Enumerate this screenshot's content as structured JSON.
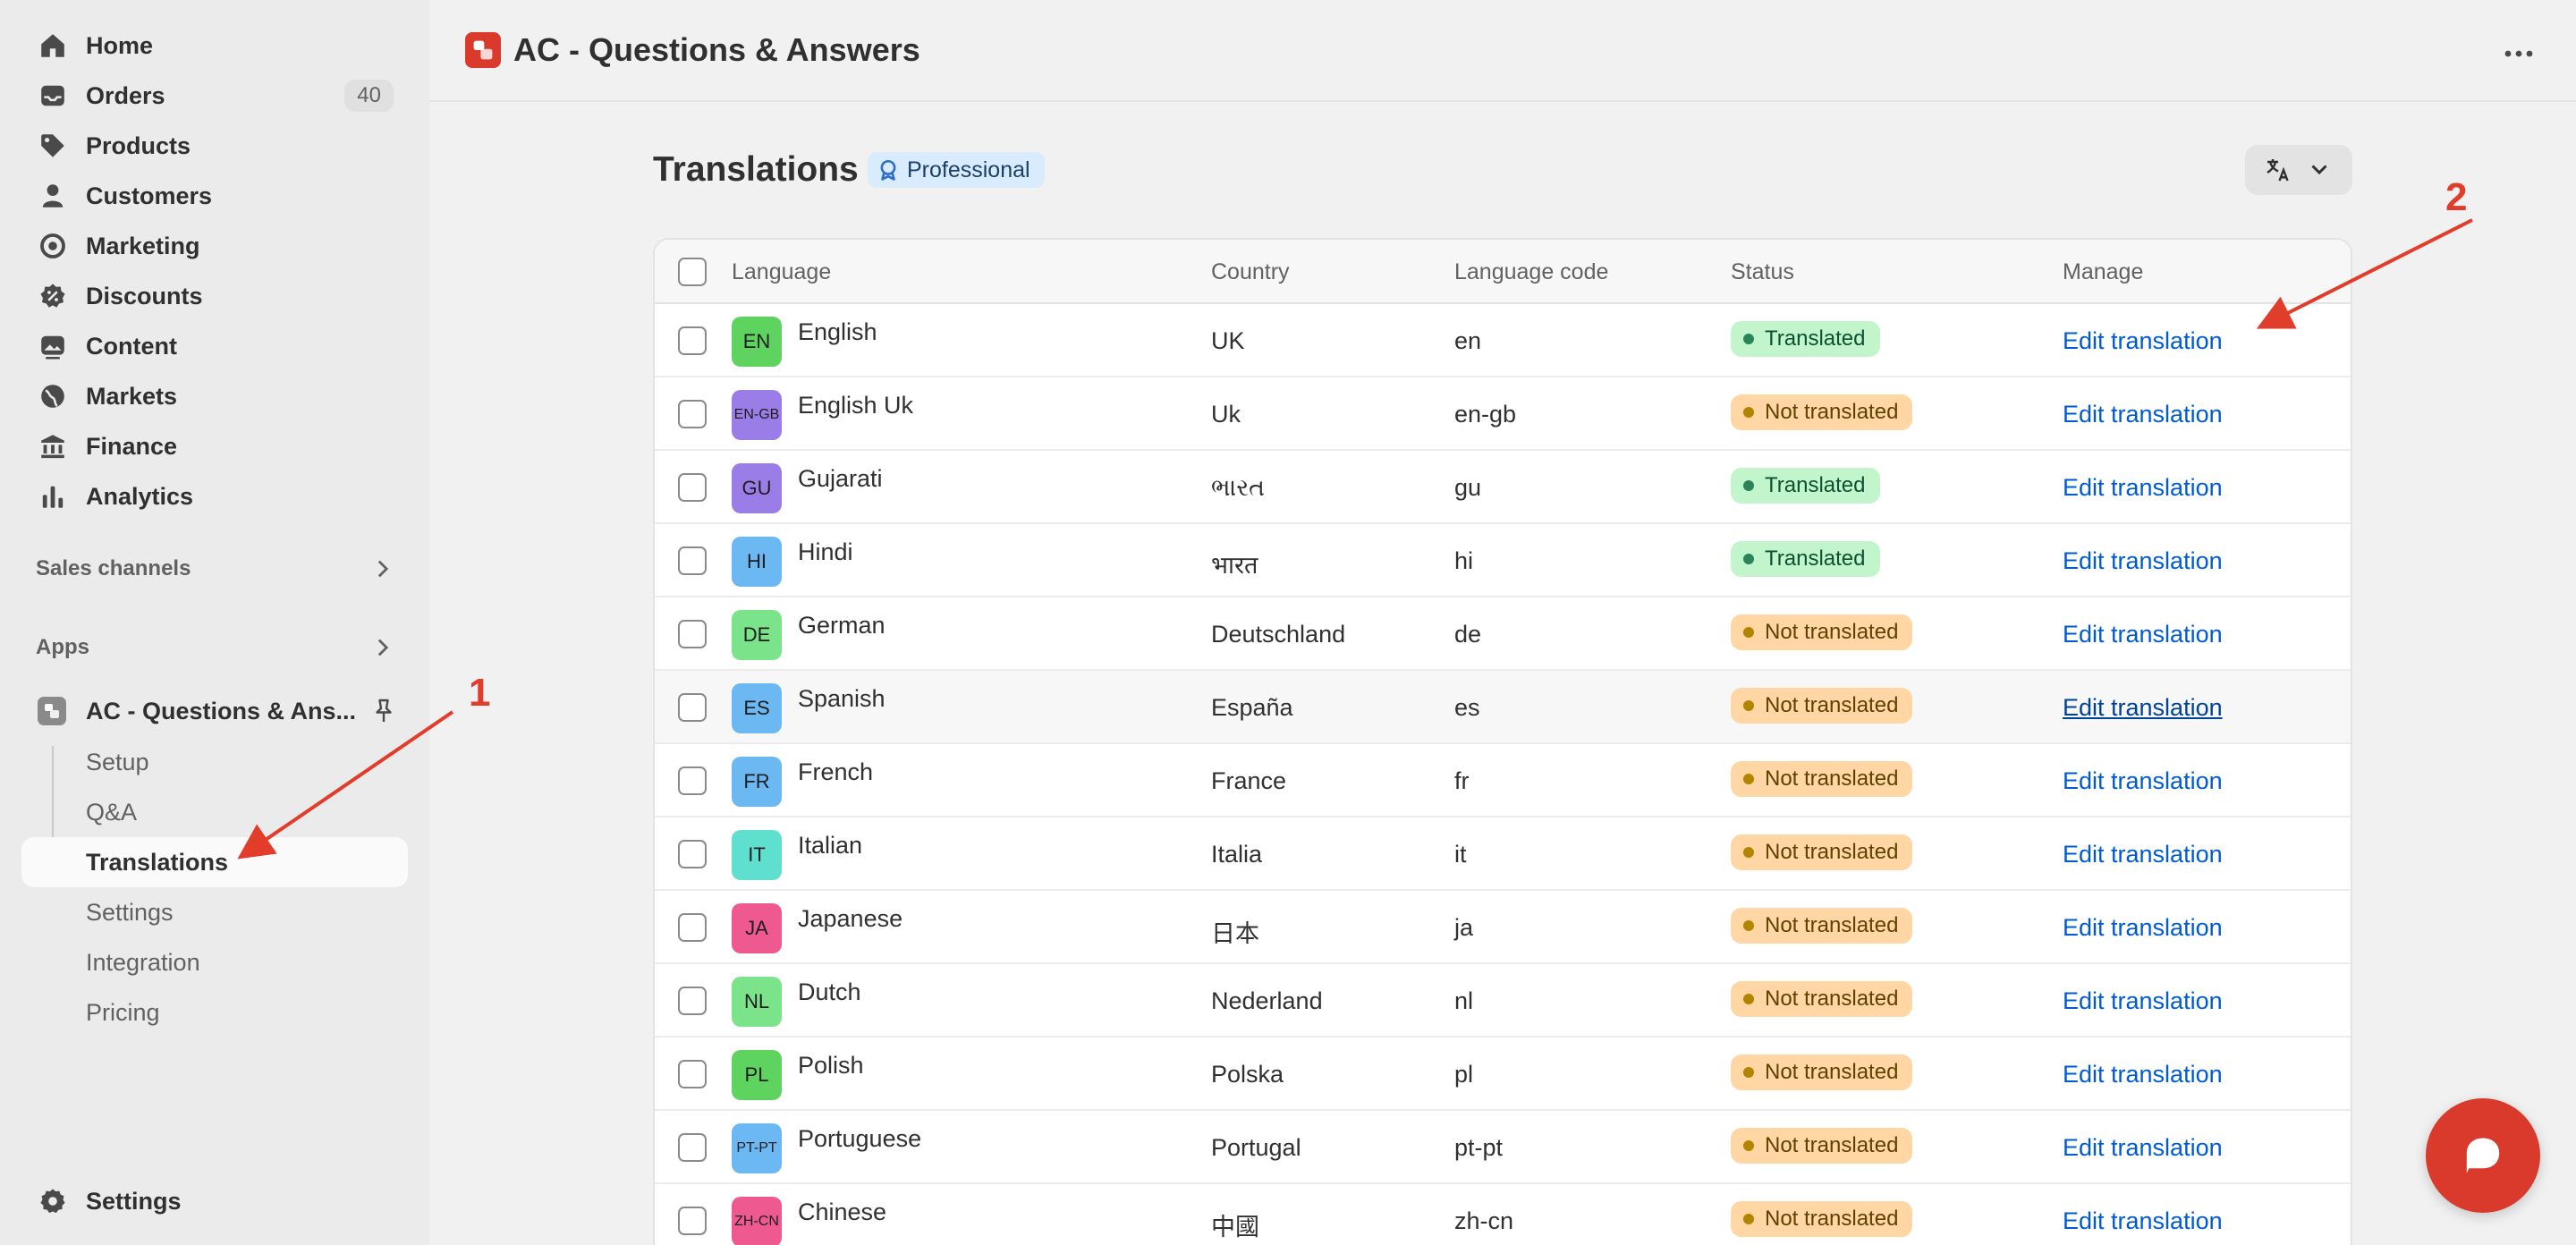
{
  "sidebar": {
    "nav": [
      {
        "label": "Home",
        "icon": "home-icon"
      },
      {
        "label": "Orders",
        "icon": "inbox-icon",
        "badge": "40"
      },
      {
        "label": "Products",
        "icon": "tag-icon"
      },
      {
        "label": "Customers",
        "icon": "person-icon"
      },
      {
        "label": "Marketing",
        "icon": "target-icon"
      },
      {
        "label": "Discounts",
        "icon": "discount-icon"
      },
      {
        "label": "Content",
        "icon": "image-icon"
      },
      {
        "label": "Markets",
        "icon": "globe-icon"
      },
      {
        "label": "Finance",
        "icon": "bank-icon"
      },
      {
        "label": "Analytics",
        "icon": "bar-chart-icon"
      }
    ],
    "sales_channels": "Sales channels",
    "apps": "Apps",
    "app_name": "AC - Questions & Ans...",
    "app_subitems": [
      "Setup",
      "Q&A",
      "Translations",
      "Settings",
      "Integration",
      "Pricing"
    ],
    "settings": "Settings"
  },
  "topbar": {
    "app_title": "AC - Questions & Answers"
  },
  "page": {
    "title": "Translations",
    "plan_badge": "Professional"
  },
  "table": {
    "headers": [
      "Language",
      "Country",
      "Language code",
      "Status",
      "Manage"
    ],
    "rows": [
      {
        "badge": "EN",
        "badge_color": "#5fd35f",
        "language": "English",
        "country": "UK",
        "code": "en",
        "status": "Translated",
        "translated": true,
        "manage": "Edit translation"
      },
      {
        "badge": "EN-GB",
        "badge_color": "#9b7de8",
        "language": "English Uk",
        "country": "Uk",
        "code": "en-gb",
        "status": "Not translated",
        "translated": false,
        "manage": "Edit translation"
      },
      {
        "badge": "GU",
        "badge_color": "#9b7de8",
        "language": "Gujarati",
        "country": "ભારત",
        "code": "gu",
        "status": "Translated",
        "translated": true,
        "manage": "Edit translation"
      },
      {
        "badge": "HI",
        "badge_color": "#6cb8f2",
        "language": "Hindi",
        "country": "भारत",
        "code": "hi",
        "status": "Translated",
        "translated": true,
        "manage": "Edit translation"
      },
      {
        "badge": "DE",
        "badge_color": "#7be38a",
        "language": "German",
        "country": "Deutschland",
        "code": "de",
        "status": "Not translated",
        "translated": false,
        "manage": "Edit translation"
      },
      {
        "badge": "ES",
        "badge_color": "#6cb8f2",
        "language": "Spanish",
        "country": "España",
        "code": "es",
        "status": "Not translated",
        "translated": false,
        "manage": "Edit translation"
      },
      {
        "badge": "FR",
        "badge_color": "#6cb8f2",
        "language": "French",
        "country": "France",
        "code": "fr",
        "status": "Not translated",
        "translated": false,
        "manage": "Edit translation"
      },
      {
        "badge": "IT",
        "badge_color": "#5fe0cf",
        "language": "Italian",
        "country": "Italia",
        "code": "it",
        "status": "Not translated",
        "translated": false,
        "manage": "Edit translation"
      },
      {
        "badge": "JA",
        "badge_color": "#ee5a90",
        "language": "Japanese",
        "country": "日本",
        "code": "ja",
        "status": "Not translated",
        "translated": false,
        "manage": "Edit translation"
      },
      {
        "badge": "NL",
        "badge_color": "#7be38a",
        "language": "Dutch",
        "country": "Nederland",
        "code": "nl",
        "status": "Not translated",
        "translated": false,
        "manage": "Edit translation"
      },
      {
        "badge": "PL",
        "badge_color": "#5fd35f",
        "language": "Polish",
        "country": "Polska",
        "code": "pl",
        "status": "Not translated",
        "translated": false,
        "manage": "Edit translation"
      },
      {
        "badge": "PT-PT",
        "badge_color": "#6cb8f2",
        "language": "Portuguese",
        "country": "Portugal",
        "code": "pt-pt",
        "status": "Not translated",
        "translated": false,
        "manage": "Edit translation"
      },
      {
        "badge": "ZH-CN",
        "badge_color": "#ee5a90",
        "language": "Chinese",
        "country": "中國",
        "code": "zh-cn",
        "status": "Not translated",
        "translated": false,
        "manage": "Edit translation"
      }
    ]
  },
  "annotations": {
    "label_1": "1",
    "label_2": "2",
    "color": "#e23c2b"
  }
}
